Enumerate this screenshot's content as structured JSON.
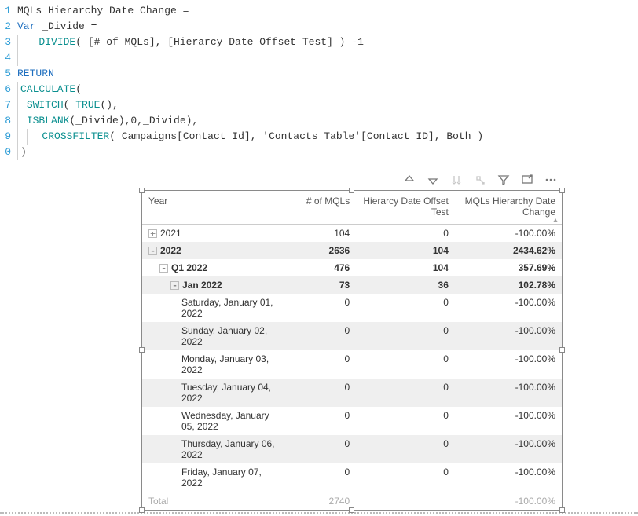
{
  "code": {
    "line1": "MQLs Hierarchy Date Change =",
    "line2_kw": "Var",
    "line2_rest": " _Divide =",
    "line3_fn": "DIVIDE",
    "line3_rest": "( [# of MQLs], [Hierarcy Date Offset Test] ) -1",
    "line5": "RETURN",
    "line6_fn": "CALCULATE",
    "line6_rest": "(",
    "line7_fn": "SWITCH",
    "line7_mid": "( ",
    "line7_fn2": "TRUE",
    "line7_end": "(),",
    "line8_fn": "ISBLANK",
    "line8_rest": "(_Divide),0,_Divide),",
    "line9_fn": "CROSSFILTER",
    "line9_rest": "( Campaigns[Contact Id], 'Contacts Table'[Contact ID], Both )",
    "line10": ")"
  },
  "table": {
    "headers": {
      "year": "Year",
      "mqls": "# of MQLs",
      "offset": "Hierarcy Date Offset Test",
      "change": "MQLs Hierarchy Date Change"
    },
    "rows": [
      {
        "indent": 0,
        "exp": "+",
        "label": "2021",
        "mqls": "104",
        "offset": "0",
        "change": "-100.00%",
        "bold": false,
        "z": false
      },
      {
        "indent": 0,
        "exp": "-",
        "label": "2022",
        "mqls": "2636",
        "offset": "104",
        "change": "2434.62%",
        "bold": true,
        "z": true
      },
      {
        "indent": 1,
        "exp": "-",
        "label": "Q1 2022",
        "mqls": "476",
        "offset": "104",
        "change": "357.69%",
        "bold": true,
        "z": false
      },
      {
        "indent": 2,
        "exp": "-",
        "label": "Jan 2022",
        "mqls": "73",
        "offset": "36",
        "change": "102.78%",
        "bold": true,
        "z": true
      },
      {
        "indent": 3,
        "exp": "",
        "label": "Saturday, January 01, 2022",
        "mqls": "0",
        "offset": "0",
        "change": "-100.00%",
        "bold": false,
        "z": false
      },
      {
        "indent": 3,
        "exp": "",
        "label": "Sunday, January 02, 2022",
        "mqls": "0",
        "offset": "0",
        "change": "-100.00%",
        "bold": false,
        "z": true
      },
      {
        "indent": 3,
        "exp": "",
        "label": "Monday, January 03, 2022",
        "mqls": "0",
        "offset": "0",
        "change": "-100.00%",
        "bold": false,
        "z": false
      },
      {
        "indent": 3,
        "exp": "",
        "label": "Tuesday, January 04, 2022",
        "mqls": "0",
        "offset": "0",
        "change": "-100.00%",
        "bold": false,
        "z": true
      },
      {
        "indent": 3,
        "exp": "",
        "label": "Wednesday, January 05, 2022",
        "mqls": "0",
        "offset": "0",
        "change": "-100.00%",
        "bold": false,
        "z": false
      },
      {
        "indent": 3,
        "exp": "",
        "label": "Thursday, January 06, 2022",
        "mqls": "0",
        "offset": "0",
        "change": "-100.00%",
        "bold": false,
        "z": true
      },
      {
        "indent": 3,
        "exp": "",
        "label": "Friday, January 07, 2022",
        "mqls": "0",
        "offset": "0",
        "change": "-100.00%",
        "bold": false,
        "z": false
      }
    ],
    "total": {
      "label": "Total",
      "mqls": "2740",
      "offset": "",
      "change": "-100.00%"
    }
  },
  "chart_data": {
    "type": "table",
    "title": "MQLs Hierarchy Date Change by Year",
    "columns": [
      "Year",
      "# of MQLs",
      "Hierarcy Date Offset Test",
      "MQLs Hierarchy Date Change"
    ],
    "rows": [
      [
        "2021",
        104,
        0,
        "-100.00%"
      ],
      [
        "2022",
        2636,
        104,
        "2434.62%"
      ],
      [
        "Q1 2022",
        476,
        104,
        "357.69%"
      ],
      [
        "Jan 2022",
        73,
        36,
        "102.78%"
      ],
      [
        "Saturday, January 01, 2022",
        0,
        0,
        "-100.00%"
      ],
      [
        "Sunday, January 02, 2022",
        0,
        0,
        "-100.00%"
      ],
      [
        "Monday, January 03, 2022",
        0,
        0,
        "-100.00%"
      ],
      [
        "Tuesday, January 04, 2022",
        0,
        0,
        "-100.00%"
      ],
      [
        "Wednesday, January 05, 2022",
        0,
        0,
        "-100.00%"
      ],
      [
        "Thursday, January 06, 2022",
        0,
        0,
        "-100.00%"
      ],
      [
        "Friday, January 07, 2022",
        0,
        0,
        "-100.00%"
      ]
    ],
    "total": [
      "Total",
      2740,
      null,
      "-100.00%"
    ]
  }
}
